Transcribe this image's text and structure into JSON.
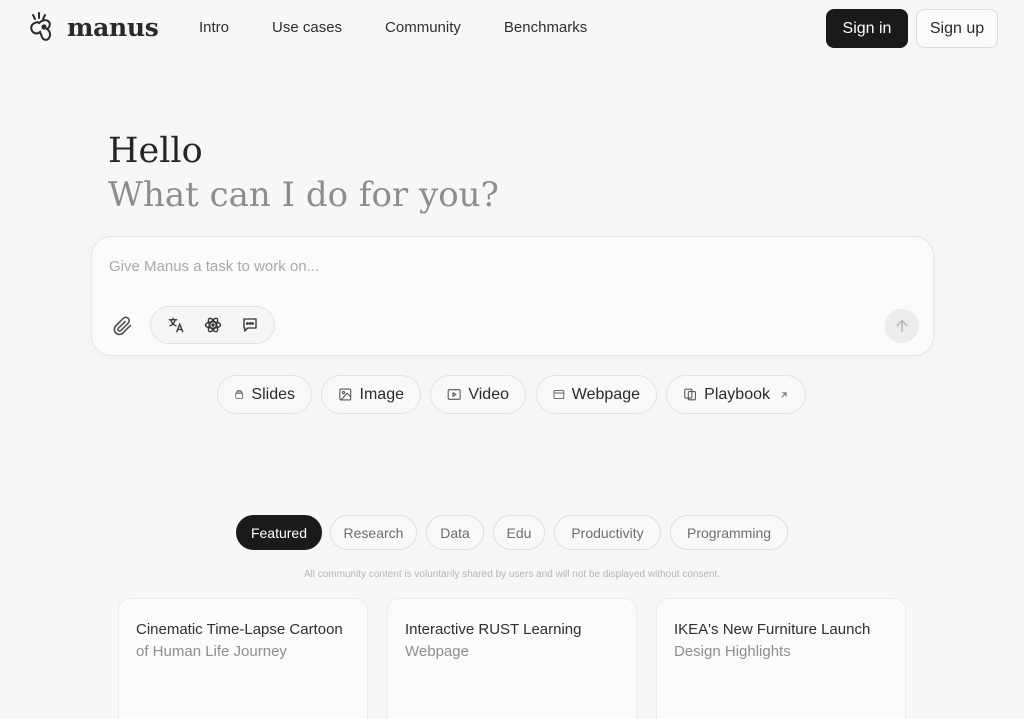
{
  "header": {
    "logo_text": "manus",
    "nav": [
      "Intro",
      "Use cases",
      "Community",
      "Benchmarks"
    ],
    "sign_in": "Sign in",
    "sign_up": "Sign up"
  },
  "hero": {
    "greeting": "Hello",
    "question": "What can I do for you?"
  },
  "task": {
    "placeholder": "Give Manus a task to work on..."
  },
  "quick_actions": [
    "Slides",
    "Image",
    "Video",
    "Webpage",
    "Playbook"
  ],
  "filters": {
    "active": "Featured",
    "items": [
      "Featured",
      "Research",
      "Data",
      "Edu",
      "Productivity",
      "Programming"
    ]
  },
  "disclaimer": "All community content is voluntarily shared by users and will not be displayed without consent.",
  "cards": [
    {
      "title": "Cinematic Time-Lapse Cartoon",
      "subtitle": "of Human Life Journey"
    },
    {
      "title": "Interactive RUST Learning",
      "subtitle": "Webpage"
    },
    {
      "title": "IKEA's New Furniture Launch",
      "subtitle": "Design Highlights"
    }
  ],
  "colors": {
    "background": "#f7f7f6",
    "primary_button": "#1a1a1a",
    "muted_text": "#8d8d8b"
  }
}
